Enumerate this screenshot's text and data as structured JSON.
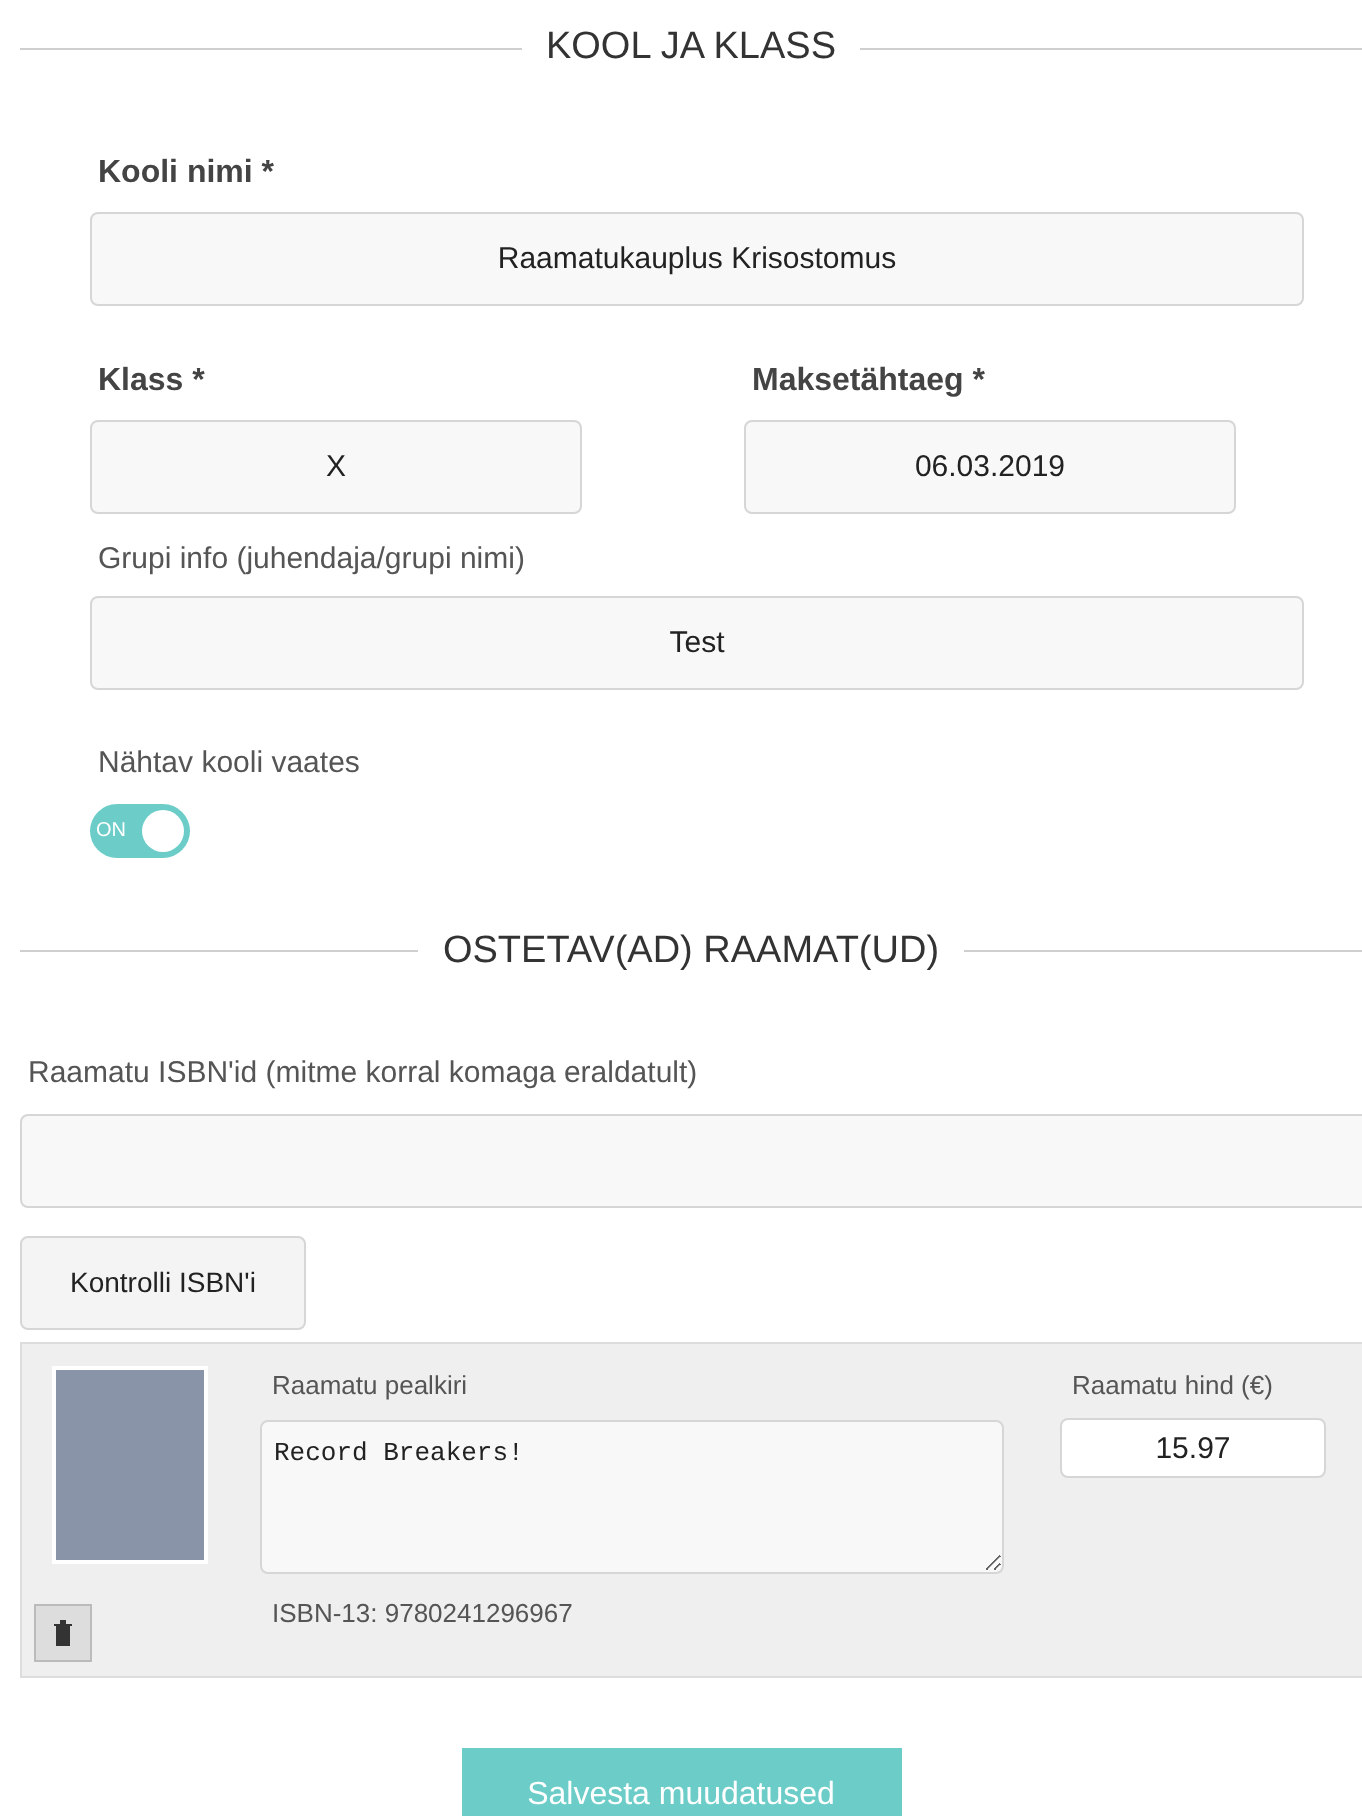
{
  "school_section": {
    "heading": "KOOL JA KLASS",
    "school_name": {
      "label": "Kooli nimi *",
      "value": "Raamatukauplus Krisostomus"
    },
    "class": {
      "label": "Klass *",
      "value": "X"
    },
    "due_date": {
      "label": "Maksetähtaeg *",
      "value": "06.03.2019"
    },
    "group_info": {
      "label": "Grupi info (juhendaja/grupi nimi)",
      "value": "Test"
    },
    "visible": {
      "label": "Nähtav kooli vaates",
      "on": true,
      "state_text": "ON"
    }
  },
  "books_section": {
    "heading": "OSTETAV(AD) RAAMAT(UD)",
    "isbn_field": {
      "label": "Raamatu ISBN'id (mitme korral komaga eraldatult)"
    },
    "check_button": "Kontrolli ISBN'i",
    "books": [
      {
        "title_label": "Raamatu pealkiri",
        "title": "Record Breakers!",
        "isbn": "ISBN-13: 9780241296967",
        "price_label": "Raamatu hind (€)",
        "price": "15.97"
      }
    ]
  },
  "save_button": "Salvesta muudatused"
}
